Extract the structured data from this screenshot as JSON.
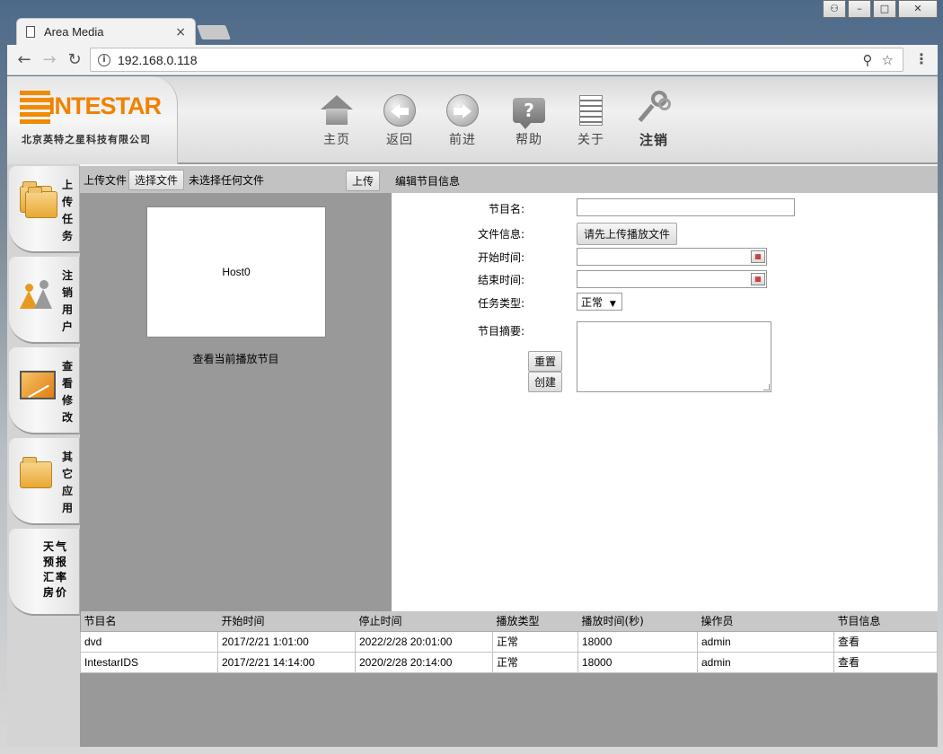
{
  "browser": {
    "tab_title": "Area Media",
    "tab_close": "×",
    "url": "192.168.0.118",
    "back": "←",
    "forward": "→",
    "reload": "↻",
    "menu": "⋮",
    "star": "☆",
    "key": "⚲",
    "win_user": "⚇",
    "win_min": "–",
    "win_max": "□",
    "win_close": "✕"
  },
  "header": {
    "logo_text": "INTESTAR",
    "logo_sub": "北京英特之星科技有限公司",
    "nav": [
      {
        "label": "主页",
        "icon": "home-icon"
      },
      {
        "label": "返回",
        "icon": "back-arrow-icon"
      },
      {
        "label": "前进",
        "icon": "forward-arrow-icon"
      },
      {
        "label": "帮助",
        "icon": "help-icon"
      },
      {
        "label": "关于",
        "icon": "document-icon"
      },
      {
        "label": "注销",
        "icon": "keys-icon"
      }
    ]
  },
  "sidebar": {
    "items": [
      {
        "label": "上传任务",
        "icon": "folder-icon"
      },
      {
        "label": "注销用户",
        "icon": "users-icon"
      },
      {
        "label": "查看修改",
        "icon": "monitor-chart-icon"
      },
      {
        "label": "其它应用",
        "icon": "folder-icon"
      },
      {
        "label": "天气预报汇率房价",
        "icon": ""
      }
    ]
  },
  "upload": {
    "label": "上传文件",
    "choose_file": "选择文件",
    "no_file": "未选择任何文件",
    "upload_button": "上传",
    "edit_label": "编辑节目信息"
  },
  "preview": {
    "host": "Host0",
    "view_current": "查看当前播放节目"
  },
  "form": {
    "program_name_label": "节目名:",
    "program_name_value": "",
    "file_info_label": "文件信息:",
    "file_info_button": "请先上传播放文件",
    "start_time_label": "开始时间:",
    "start_time_value": "",
    "end_time_label": "结束时间:",
    "end_time_value": "",
    "task_type_label": "任务类型:",
    "task_type_value": "正常",
    "summary_label": "节目摘要:",
    "summary_value": "",
    "reset_button": "重置",
    "create_button": "创建"
  },
  "table": {
    "headers": [
      "节目名",
      "开始时间",
      "停止时间",
      "播放类型",
      "播放时间(秒)",
      "操作员",
      "节目信息"
    ],
    "rows": [
      [
        "dvd",
        "2017/2/21 1:01:00",
        "2022/2/28 20:01:00",
        "正常",
        "18000",
        "admin",
        "查看"
      ],
      [
        "IntestarIDS",
        "2017/2/21 14:14:00",
        "2020/2/28 20:14:00",
        "正常",
        "18000",
        "admin",
        "查看"
      ]
    ]
  }
}
